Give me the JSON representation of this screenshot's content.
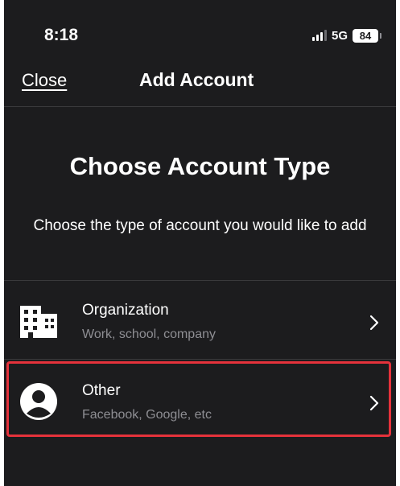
{
  "status_bar": {
    "time": "8:18",
    "network": "5G",
    "battery": "84"
  },
  "nav": {
    "close_label": "Close",
    "title": "Add Account"
  },
  "main": {
    "heading": "Choose Account Type",
    "subheading": "Choose the type of account you would like to add"
  },
  "account_types": [
    {
      "title": "Organization",
      "subtitle": "Work, school, company",
      "icon": "building-icon"
    },
    {
      "title": "Other",
      "subtitle": "Facebook, Google, etc",
      "icon": "person-icon",
      "highlighted": true
    }
  ],
  "colors": {
    "background": "#1c1c1e",
    "text": "#ffffff",
    "secondary_text": "#8e8e93",
    "highlight": "#e5323b"
  }
}
